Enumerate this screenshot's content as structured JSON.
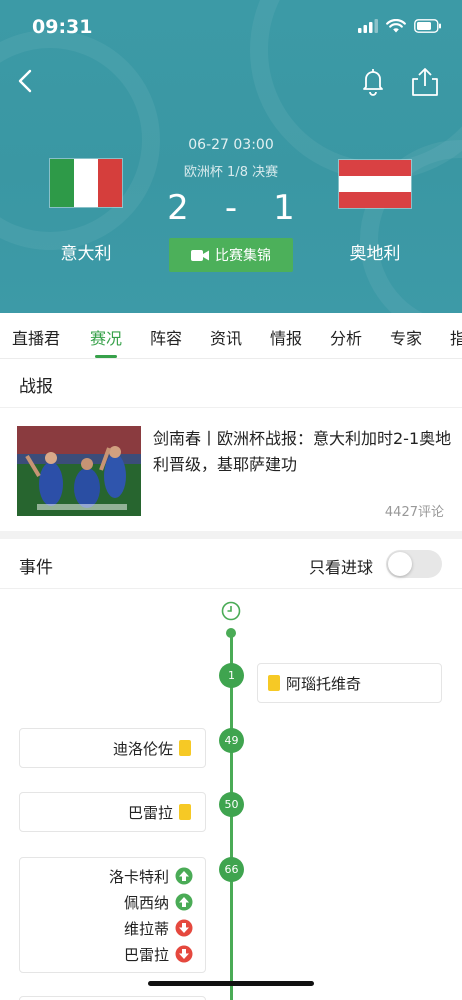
{
  "status_bar": {
    "time": "09:31"
  },
  "match": {
    "datetime": "06-27 03:00",
    "competition": "欧洲杯 1/8 决赛",
    "home_team": "意大利",
    "away_team": "奥地利",
    "home_score": "2",
    "separator": "-",
    "away_score": "1",
    "highlights_label": "比赛集锦"
  },
  "tabs": [
    "直播君",
    "赛况",
    "阵容",
    "资讯",
    "情报",
    "分析",
    "专家",
    "指"
  ],
  "active_tab": "赛况",
  "report": {
    "section_title": "战报",
    "title": "剑南春丨欧洲杯战报：意大利加时2-1奥地利晋级，基耶萨建功",
    "comments": "4427评论"
  },
  "events": {
    "section_title": "事件",
    "goal_filter_label": "只看进球",
    "goal_filter_on": false,
    "items": [
      {
        "minute": "1",
        "side": "away",
        "type": "yellow",
        "player": "阿瑙托维奇"
      },
      {
        "minute": "49",
        "side": "home",
        "type": "yellow",
        "player": "迪洛伦佐"
      },
      {
        "minute": "50",
        "side": "home",
        "type": "yellow",
        "player": "巴雷拉"
      },
      {
        "minute": "66",
        "side": "home",
        "type": "substitution",
        "in": [
          "洛卡特利",
          "佩西纳"
        ],
        "out": [
          "维拉蒂",
          "巴雷拉"
        ]
      }
    ]
  },
  "colors": {
    "accent": "#37a14a",
    "header_bg": "#3a97a3",
    "yellow_card": "#f6c925",
    "sub_in": "#4aab56",
    "sub_out": "#e5483e"
  }
}
